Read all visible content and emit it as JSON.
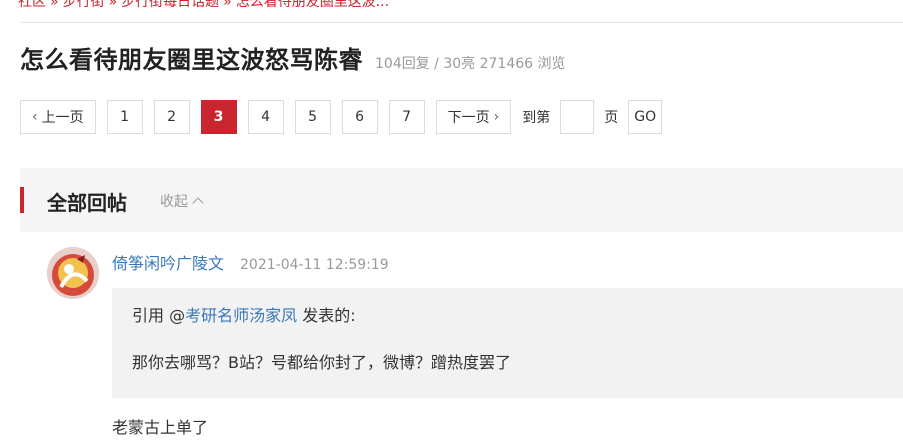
{
  "breadcrumb": {
    "items": [
      "社区",
      "步行街",
      "步行街每日话题",
      "怎么看待朋友圈里这波..."
    ],
    "separator": "»"
  },
  "thread": {
    "title": "怎么看待朋友圈里这波怒骂陈睿",
    "stats": "104回复 / 30亮 271466 浏览"
  },
  "pagination": {
    "prev_label": "上一页",
    "prev_arrow": "‹",
    "pages": [
      "1",
      "2",
      "3",
      "4",
      "5",
      "6",
      "7"
    ],
    "current_page": "3",
    "next_label": "下一页",
    "next_arrow": "›",
    "jump_prefix": "到第",
    "jump_input_value": "",
    "jump_suffix": "页",
    "go_label": "GO"
  },
  "replies_section": {
    "title": "全部回帖",
    "collapse_label": "收起"
  },
  "post": {
    "author": "倚筝闲吟广陵文",
    "time": "2021-04-11 12:59:19",
    "quote": {
      "prefix": "引用 @",
      "quoted_user": "考研名师汤家凤",
      "suffix": " 发表的:",
      "body": "那你去哪骂？B站？号都给你封了，微博？蹭热度罢了"
    },
    "content": "老蒙古上单了"
  },
  "colors": {
    "accent_red": "#c9252e",
    "link_blue": "#3a78b8",
    "muted_gray": "#999999"
  }
}
